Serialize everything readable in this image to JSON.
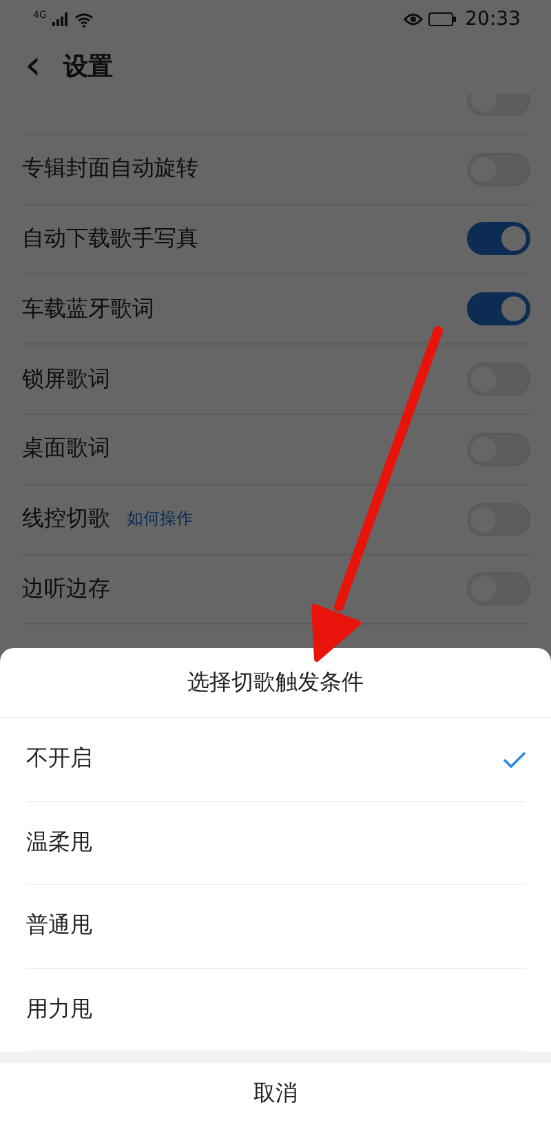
{
  "status_bar": {
    "network": "4G",
    "time": "20:33"
  },
  "header": {
    "back": "‹",
    "title": "设置"
  },
  "settings": [
    {
      "on": false
    },
    {
      "label": "专辑封面自动旋转",
      "on": false
    },
    {
      "label": "自动下载歌手写真",
      "on": true
    },
    {
      "label": "车载蓝牙歌词",
      "on": true
    },
    {
      "label": "锁屏歌词",
      "on": false
    },
    {
      "label": "桌面歌词",
      "on": false
    },
    {
      "label": "线控切歌",
      "link": "如何操作",
      "on": false
    },
    {
      "label": "边听边存",
      "on": false
    }
  ],
  "sheet": {
    "title": "选择切歌触发条件",
    "options": [
      {
        "label": "不开启",
        "selected": true
      },
      {
        "label": "温柔甩",
        "selected": false
      },
      {
        "label": "普通甩",
        "selected": false
      },
      {
        "label": "用力甩",
        "selected": false
      }
    ],
    "cancel": "取消"
  }
}
